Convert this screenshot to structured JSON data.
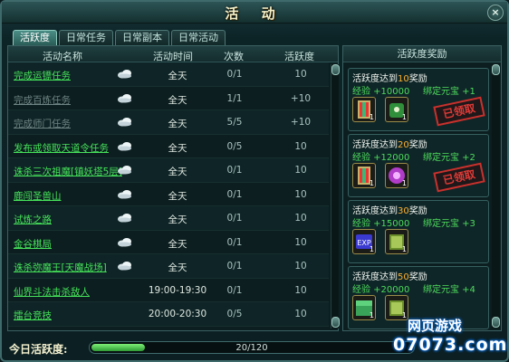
{
  "window": {
    "title": "活 动",
    "close_label": "×"
  },
  "tabs": [
    {
      "label": "活跃度",
      "active": true
    },
    {
      "label": "日常任务",
      "active": false
    },
    {
      "label": "日常副本",
      "active": false
    },
    {
      "label": "日常活动",
      "active": false
    }
  ],
  "table": {
    "headers": {
      "name": "活动名称",
      "time": "活动时间",
      "count": "次数",
      "activity": "活跃度"
    },
    "rows": [
      {
        "name": "完成运镖任务",
        "time": "全天",
        "count": "0/1",
        "activity": "10",
        "done": false,
        "cloud": true
      },
      {
        "name": "完成百炼任务",
        "time": "全天",
        "count": "1/1",
        "activity": "+10",
        "done": true,
        "cloud": true
      },
      {
        "name": "完成师门任务",
        "time": "全天",
        "count": "5/5",
        "activity": "+10",
        "done": true,
        "cloud": true
      },
      {
        "name": "发布或领取天道令任务",
        "time": "全天",
        "count": "0/5",
        "activity": "10",
        "done": false,
        "cloud": true
      },
      {
        "name": "诛杀三次祖魔[镇妖塔5层]",
        "time": "全天",
        "count": "0/1",
        "activity": "10",
        "done": false,
        "cloud": true
      },
      {
        "name": "鹿闯圣兽山",
        "time": "全天",
        "count": "0/1",
        "activity": "10",
        "done": false,
        "cloud": true
      },
      {
        "name": "试炼之路",
        "time": "全天",
        "count": "0/1",
        "activity": "10",
        "done": false,
        "cloud": true
      },
      {
        "name": "金谷棋局",
        "time": "全天",
        "count": "0/1",
        "activity": "10",
        "done": false,
        "cloud": true
      },
      {
        "name": "诛杀弥魔王[天魔战场]",
        "time": "全天",
        "count": "0/1",
        "activity": "10",
        "done": false,
        "cloud": true
      },
      {
        "name": "仙界斗法击杀敌人",
        "time": "19:00-19:30",
        "count": "0/1",
        "activity": "10",
        "done": false,
        "cloud": false
      },
      {
        "name": "擂台竞技",
        "time": "20:00-20:30",
        "count": "0/5",
        "activity": "10",
        "done": false,
        "cloud": false
      }
    ]
  },
  "rewards": {
    "header": "活跃度奖励",
    "items": [
      {
        "title_prefix": "活跃度达到",
        "threshold": "10",
        "title_suffix": "奖励",
        "exp": "经验 +10000",
        "gold": "绑定元宝 +1",
        "claimed": true,
        "stamp": "已领取",
        "icons": [
          "scroll-icon",
          "lock-bag-icon"
        ]
      },
      {
        "title_prefix": "活跃度达到",
        "threshold": "20",
        "title_suffix": "奖励",
        "exp": "经验 +12000",
        "gold": "绑定元宝 +2",
        "claimed": true,
        "stamp": "已领取",
        "icons": [
          "scroll-icon",
          "orb-icon"
        ]
      },
      {
        "title_prefix": "活跃度达到",
        "threshold": "30",
        "title_suffix": "奖励",
        "exp": "经验 +15000",
        "gold": "绑定元宝 +3",
        "claimed": false,
        "stamp": "",
        "icons": [
          "exp-card-icon",
          "book-icon"
        ]
      },
      {
        "title_prefix": "活跃度达到",
        "threshold": "50",
        "title_suffix": "奖励",
        "exp": "经验 +20000",
        "gold": "绑定元宝 +4",
        "claimed": false,
        "stamp": "",
        "icons": [
          "chest-icon",
          "book-icon"
        ]
      }
    ],
    "item_quantity": "1"
  },
  "progress": {
    "label": "今日活跃度:",
    "text": "20/120",
    "value": 20,
    "max": 120
  },
  "watermark": {
    "top": "网页游戏",
    "bottom": "07073.com"
  },
  "colors": {
    "accent_green": "#46e35a",
    "stamp_red": "#c8312d",
    "threshold_orange": "#ffb02e"
  }
}
